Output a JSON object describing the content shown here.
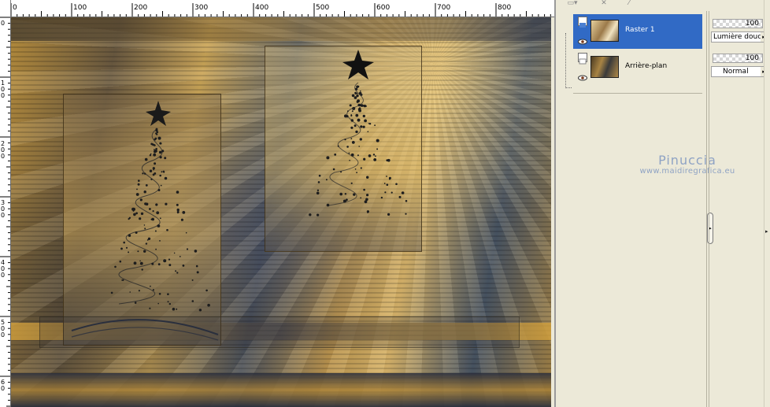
{
  "ruler": {
    "top_labels": [
      "0",
      "100",
      "200",
      "300",
      "400",
      "500",
      "600",
      "700",
      "800"
    ],
    "left_labels": [
      "0",
      "1 0 0",
      "2 0 0",
      "3 0 0",
      "4 0 0",
      "5 0 0",
      "6 0"
    ]
  },
  "layers": [
    {
      "name": "Raster 1",
      "selected": true,
      "opacity": "100",
      "blend_mode": "Lumière douce"
    },
    {
      "name": "Arrière-plan",
      "selected": false,
      "opacity": "100",
      "blend_mode": "Normal"
    }
  ],
  "watermark": {
    "title": "Pinuccia",
    "url": "www.maidiregrafica.eu"
  },
  "icons": {
    "eye": "eye-icon",
    "raster_layer": "raster-layer-icon",
    "dropdown": "chevron-right-icon",
    "collapse": "arrow-right-icon"
  },
  "colors": {
    "selection": "#316ac5",
    "panel_bg": "#ece9d8",
    "watermark": "#8fa3c4"
  }
}
